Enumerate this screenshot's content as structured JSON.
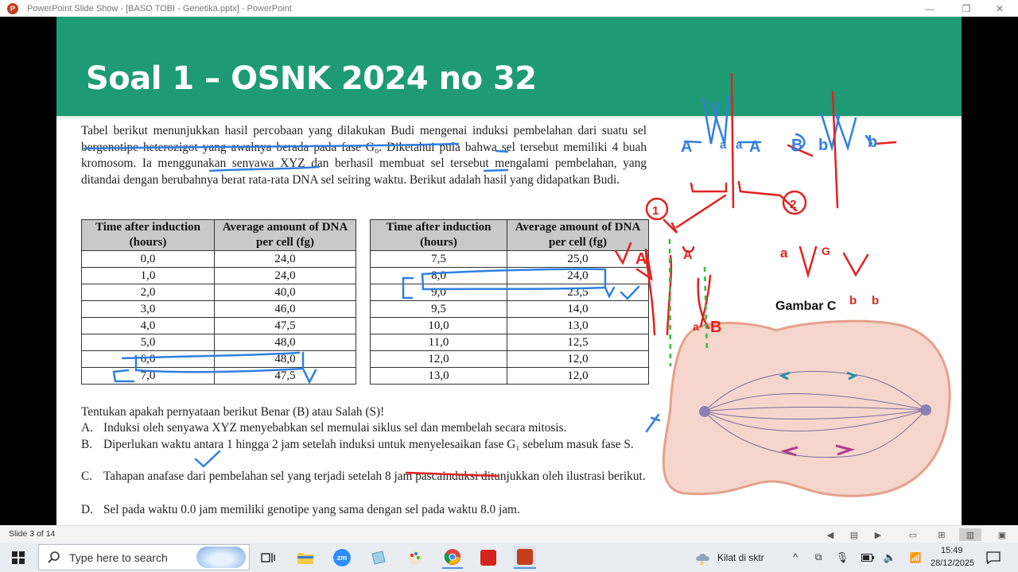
{
  "window": {
    "title": "PowerPoint Slide Show - [BASO TOBI - Genetika.pptx] - PowerPoint",
    "app_icon_letter": "P",
    "minimize": "—",
    "restore": "❐",
    "close": "✕"
  },
  "slide": {
    "title": "Soal 1 – OSNK 2024 no 32",
    "paragraph": "Tabel berikut menunjukkan hasil percobaan yang dilakukan Budi mengenai induksi pembelahan dari suatu sel bergenotipe heterozigot yang awalnya berada pada fase G₀. Diketahui pula bahwa sel tersebut memiliki 4 buah kromosom. Ia menggunakan senyawa XYZ dan berhasil membuat sel tersebut mengalami pembelahan, yang ditandai dengan berubahnya berat rata-rata DNA sel seiring waktu. Berikut adalah hasil yang didapatkan Budi.",
    "table_headers": [
      "Time after induction (hours)",
      "Average amount of DNA per cell (fg)"
    ],
    "table1": [
      [
        "0,0",
        "24,0"
      ],
      [
        "1,0",
        "24,0"
      ],
      [
        "2,0",
        "40,0"
      ],
      [
        "3,0",
        "46,0"
      ],
      [
        "4,0",
        "47,5"
      ],
      [
        "5,0",
        "48,0"
      ],
      [
        "6,0",
        "48,0"
      ],
      [
        "7,0",
        "47,5"
      ]
    ],
    "table2": [
      [
        "7,5",
        "25,0"
      ],
      [
        "8,0",
        "24,0"
      ],
      [
        "9,0",
        "23,5"
      ],
      [
        "9,5",
        "14,0"
      ],
      [
        "10,0",
        "13,0"
      ],
      [
        "11,0",
        "12,5"
      ],
      [
        "12,0",
        "12,0"
      ],
      [
        "13,0",
        "12,0"
      ]
    ],
    "question_intro": "Tentukan apakah pernyataan berikut Benar (B) atau Salah (S)!",
    "options": [
      {
        "letter": "A.",
        "text": "Induksi oleh senyawa XYZ menyebabkan sel memulai siklus sel dan membelah secara mitosis."
      },
      {
        "letter": "B.",
        "text": "Diperlukan waktu antara 1 hingga 2 jam setelah induksi untuk menyelesaikan fase G₁ sebelum masuk fase S."
      },
      {
        "letter": "C.",
        "text": "Tahapan anafase dari pembelahan sel yang terjadi setelah 8 jam pascainduksi ditunjukkan oleh ilustrasi berikut."
      },
      {
        "letter": "D.",
        "text": "Sel pada waktu 0.0 jam memiliki genotipe yang sama dengan sel pada waktu 8.0 jam."
      }
    ],
    "figure_label": "Gambar C",
    "annotations": {
      "labels": [
        "A",
        "a",
        "a",
        "A",
        "B",
        "b",
        "b",
        "A",
        "A",
        "a",
        "B",
        "a",
        "G",
        "b",
        "b"
      ],
      "circled_numbers": [
        "1",
        "2"
      ],
      "marks": [
        "✓",
        "✓",
        "✓",
        "X"
      ]
    }
  },
  "statusbar": {
    "slide_number": "Slide 3 of 14"
  },
  "taskbar": {
    "search_placeholder": "Type here to search",
    "weather": "Kilat di sktr",
    "time": "15:49",
    "date": "28/12/2025"
  },
  "colors": {
    "banner": "#1e9b74",
    "ink_blue": "#2f7fe0",
    "ink_red": "#e0221e",
    "ink_green": "#2fbf3a",
    "cell_fill": "#f6d6cc"
  }
}
